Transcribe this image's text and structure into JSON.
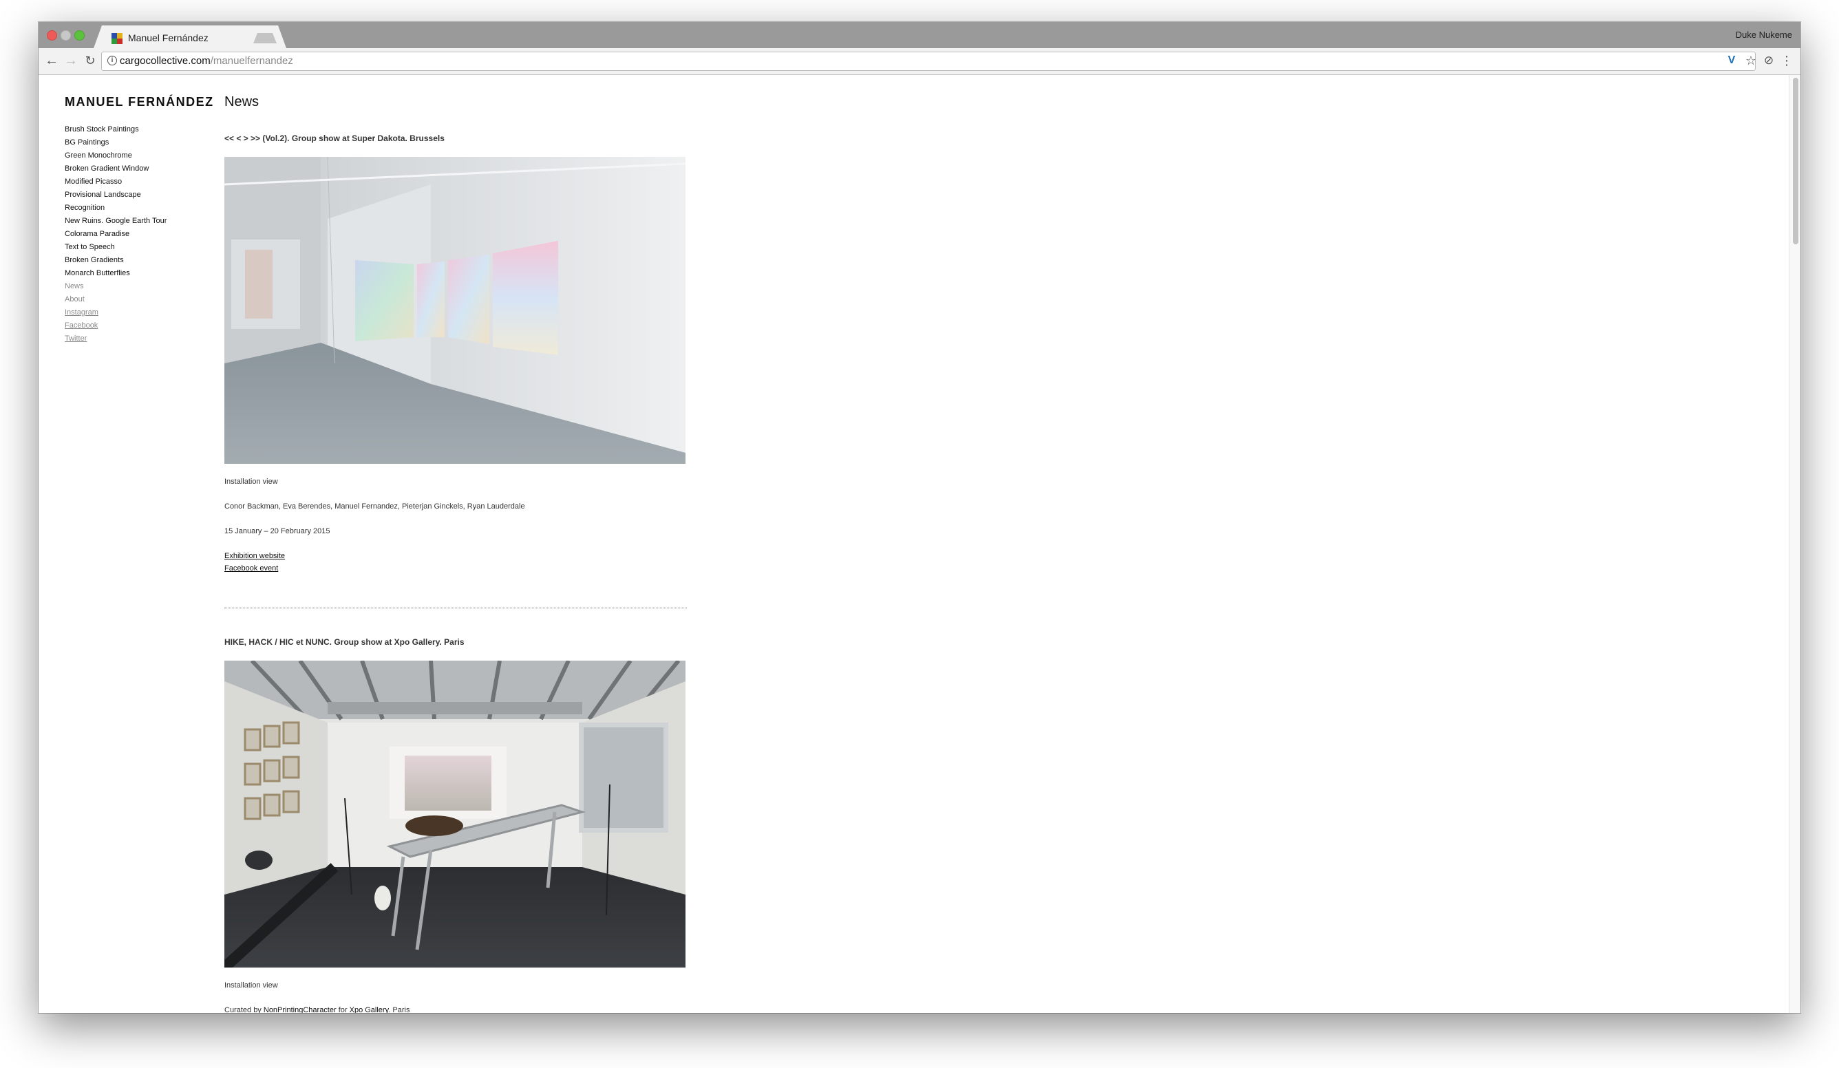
{
  "browser": {
    "tab_title": "Manuel Fernández",
    "tab_close": "×",
    "profile_name": "Duke Nukeme",
    "url_host": "cargocollective.com",
    "url_path": "/manuelfernandez",
    "icons": {
      "back": "arrow-left",
      "forward": "arrow-right",
      "reload": "reload",
      "site_info": "info",
      "extension_v": "v",
      "bookmark": "star",
      "extension_ghost": "ghost",
      "menu": "vertical-dots"
    },
    "glyphs": {
      "back": "←",
      "forward": "→",
      "reload": "↻",
      "info": "i",
      "ext_v": "V",
      "star": "☆",
      "ext_g": "⊘",
      "menu": "⋮"
    }
  },
  "site": {
    "title": "MANUEL FERNÁNDEZ",
    "nav": [
      "Brush Stock Paintings",
      "BG Paintings",
      "Green Monochrome",
      "Broken Gradient Window",
      "Modified Picasso",
      "Provisional Landscape",
      "Recognition",
      "New Ruins. Google Earth Tour",
      "Colorama Paradise",
      "Text to Speech",
      "Broken Gradients",
      "Monarch Butterflies",
      "News",
      "About",
      "Instagram",
      "Facebook",
      "Twitter"
    ]
  },
  "main": {
    "heading": "News",
    "posts": [
      {
        "title": "<< < > >> (Vol.2). Group show at Super Dakota. Brussels",
        "caption": "Installation view",
        "artists": "Conor Backman, Eva Berendes, Manuel Fernandez, Pieterjan Ginckels, Ryan Lauderdale",
        "dates": "15 January – 20 February 2015",
        "links": [
          "Exhibition website",
          "Facebook event"
        ]
      },
      {
        "title": "HIKE, HACK / HIC et NUNC. Group show at Xpo Gallery. Paris",
        "caption": "Installation view",
        "credit_prefix": "Curated by ",
        "credit_link1": "NonPrintingCharacter",
        "credit_mid": " for ",
        "credit_link2": "Xpo Gallery",
        "credit_suffix": ". Paris"
      }
    ]
  },
  "colors": {
    "tab_strip": "#9a9a9a",
    "toolbar": "#f2f2f2",
    "muted_link": "#8a8a8a"
  }
}
